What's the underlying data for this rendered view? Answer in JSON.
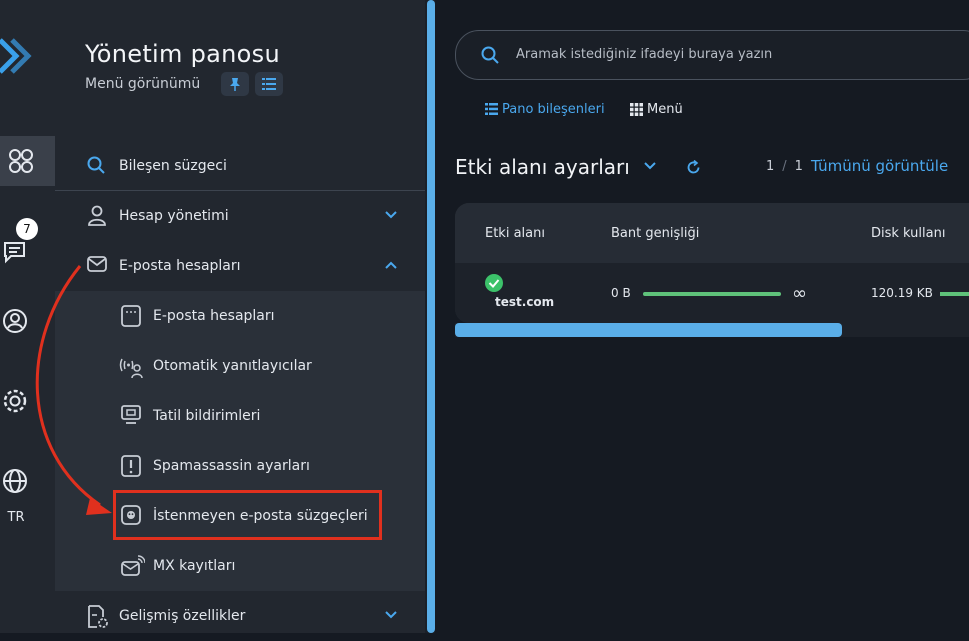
{
  "rail": {
    "badge_count": "7",
    "language": "TR"
  },
  "panel": {
    "title": "Yönetim panosu",
    "subtitle": "Menü görünümü",
    "filter_label": "Bileşen süzgeci",
    "nav": [
      {
        "label": "Hesap yönetimi",
        "expanded": false
      },
      {
        "label": "E-posta hesapları",
        "expanded": true
      },
      {
        "label": "Gelişmiş özellikler",
        "expanded": false
      }
    ],
    "sub_items": [
      {
        "label": "E-posta hesapları",
        "icon": "mailbox-icon"
      },
      {
        "label": "Otomatik yanıtlayıcılar",
        "icon": "autoresponder-icon"
      },
      {
        "label": "Tatil bildirimleri",
        "icon": "monitor-icon"
      },
      {
        "label": "Spamassassin ayarları",
        "icon": "alert-icon"
      },
      {
        "label": "İstenmeyen e-posta süzgeçleri",
        "icon": "spam-filter-icon"
      },
      {
        "label": "MX kayıtları",
        "icon": "mx-record-icon"
      }
    ]
  },
  "search": {
    "placeholder": "Aramak istediğiniz ifadeyi buraya yazın"
  },
  "tabs": {
    "components": "Pano bileşenleri",
    "menu": "Menü"
  },
  "section": {
    "title": "Etki alanı ayarları",
    "page_current": "1",
    "page_total": "1",
    "view_all": "Tümünü görüntüle"
  },
  "table": {
    "headers": [
      "Etki alanı",
      "Bant genişliği",
      "Disk kullanı"
    ],
    "rows": [
      {
        "domain": "test.com",
        "status": "ok",
        "bandwidth": "0 B",
        "bandwidth_limit": "∞",
        "disk": "120.19 KB"
      }
    ]
  },
  "colors": {
    "accent": "#4aa8ee",
    "highlight": "#e0301e",
    "success": "#3cc26a",
    "panel": "#22272f",
    "background": "#151a22"
  }
}
